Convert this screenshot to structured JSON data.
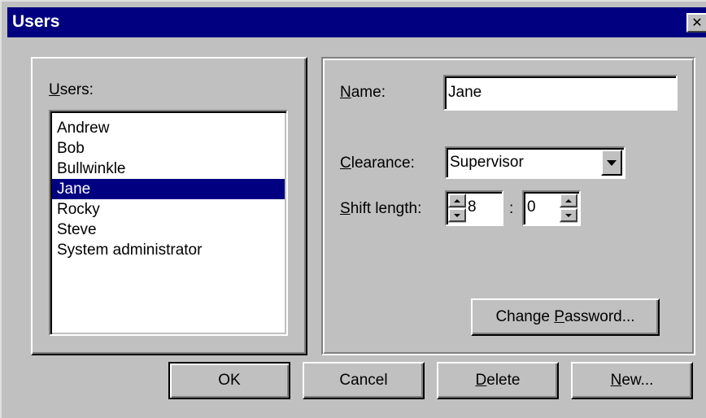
{
  "window": {
    "title": "Users",
    "close_glyph": "✕",
    "close_icon": "close-icon"
  },
  "users_panel": {
    "label_mnemonic": "U",
    "label_rest": "sers:",
    "items": [
      "Andrew",
      "Bob",
      "Bullwinkle",
      "Jane",
      "Rocky",
      "Steve",
      "System administrator"
    ],
    "selected_index": 3
  },
  "details_panel": {
    "name_label_mnemonic": "N",
    "name_label_rest": "ame:",
    "name_value": "Jane",
    "clearance_label_mnemonic": "C",
    "clearance_label_rest": "learance:",
    "clearance_value": "Supervisor",
    "shift_label_mnemonic": "S",
    "shift_label_rest": "hift length:",
    "shift_hours": "8",
    "shift_separator": ":",
    "shift_minutes": "0",
    "change_password_pre": "Change ",
    "change_password_mnemonic": "P",
    "change_password_rest": "assword..."
  },
  "buttons": {
    "ok": "OK",
    "cancel": "Cancel",
    "delete_mnemonic": "D",
    "delete_rest": "elete",
    "new_mnemonic": "N",
    "new_rest": "ew..."
  },
  "colors": {
    "titlebar": "#000080",
    "face": "#c0c0c0",
    "selection": "#000080"
  }
}
